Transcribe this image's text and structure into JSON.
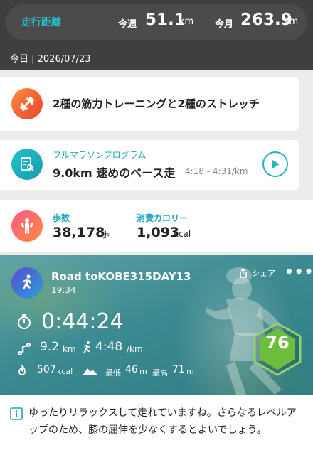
{
  "header": {
    "distance_title": "走行距離",
    "week_label": "今週",
    "week_value": "51.1",
    "week_unit": "km",
    "month_label": "今月",
    "month_value": "263.9",
    "month_unit": "km",
    "today": "今日 | 2026/07/23"
  },
  "training": {
    "icon": "dumbbell-icon",
    "text": "2種の筋力トレーニングと2種のストレッチ"
  },
  "program": {
    "icon": "plan-checklist-icon",
    "label": "フルマラソンプログラム",
    "title": "9.0km 速めのペース走",
    "pace": "4:18 - 4:31/km",
    "play_icon": "play-icon"
  },
  "daily": {
    "icon": "body-icon",
    "steps_label": "歩数",
    "steps_value": "38,178",
    "steps_unit": "歩",
    "calories_label": "消費カロリー",
    "calories_value": "1,093",
    "calories_unit": "kcal"
  },
  "activity": {
    "icon": "runner-icon",
    "title": "Road toKOBE315DAY13",
    "time": "19:34",
    "share_label": "シェア",
    "more": "•••",
    "duration": "0:44:24",
    "distance_value": "9.2",
    "distance_unit": "km",
    "pace_value": "4:48",
    "pace_unit": "/km",
    "kcal_value": "507",
    "kcal_unit": "kcal",
    "low_label": "最低",
    "low_value": "46",
    "low_unit": "m",
    "high_label": "最高",
    "high_value": "71",
    "high_unit": "m",
    "score": "76",
    "score_color": "#6cbf3a"
  },
  "advice": {
    "icon": "info-icon",
    "text": "ゆったりリラックスして走れていますね。さらなるレベルアップのため、膝の屈伸を少なくするとよいでしょう。"
  }
}
